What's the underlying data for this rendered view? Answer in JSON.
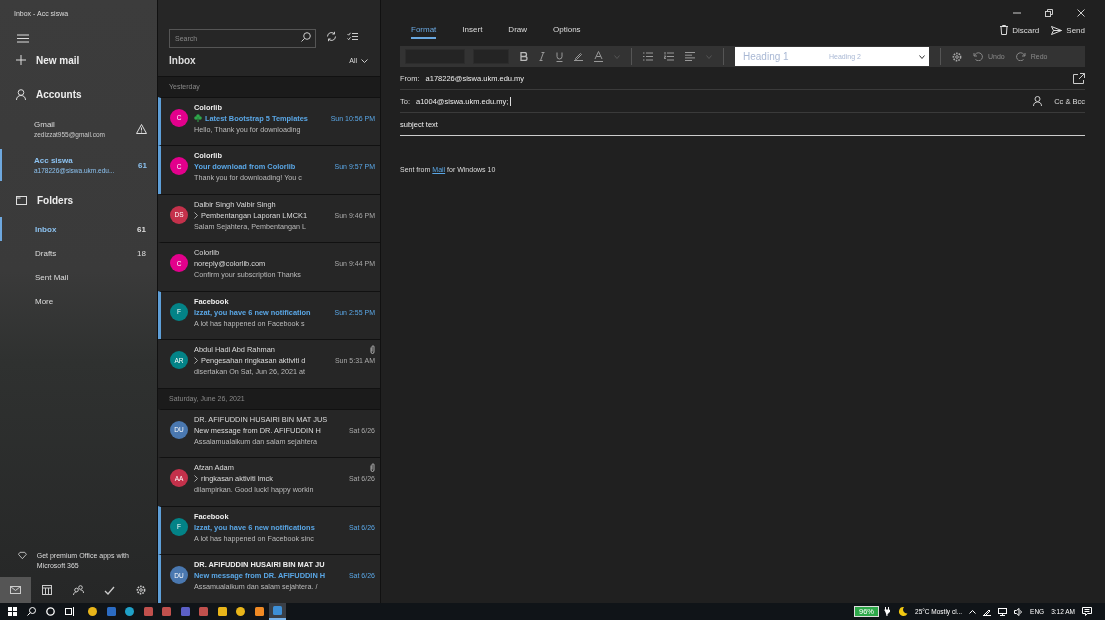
{
  "window": {
    "title": "Inbox - Acc siswa"
  },
  "sidebar": {
    "new_mail": "New mail",
    "accounts_header": "Accounts",
    "accounts": [
      {
        "name": "Gmail",
        "email": "zedizzat955@gmail.com",
        "warning": true,
        "selected": false
      },
      {
        "name": "Acc siswa",
        "email": "a178226@siswa.ukm.edu...",
        "count": "61",
        "warning": false,
        "selected": true
      }
    ],
    "folders_header": "Folders",
    "folders": [
      {
        "name": "Inbox",
        "count": "61",
        "selected": true
      },
      {
        "name": "Drafts",
        "count": "18",
        "selected": false
      },
      {
        "name": "Sent Mail",
        "selected": false
      },
      {
        "name": "More",
        "selected": false
      }
    ],
    "promo": "Get premium Office apps with Microsoft 365",
    "nav": [
      {
        "kind": "mail",
        "selected": true
      },
      {
        "kind": "calendar",
        "selected": false
      },
      {
        "kind": "people",
        "selected": false
      },
      {
        "kind": "todo",
        "selected": false
      },
      {
        "kind": "settings",
        "selected": false
      }
    ]
  },
  "message_list": {
    "search": {
      "placeholder": "Search"
    },
    "title": "Inbox",
    "filter": "All",
    "groups": [
      {
        "label": "Yesterday",
        "messages": [
          {
            "initials": "C",
            "color": "#e3008c",
            "sender": "Colorlib",
            "subject": "Latest Bootstrap 5 Templates",
            "kind": "clover",
            "preview": "Hello, Thank you for downloading",
            "time": "Sun 10:56 PM",
            "unread": true,
            "attachment": false
          },
          {
            "initials": "C",
            "color": "#e3008c",
            "sender": "Colorlib",
            "subject": "Your download from Colorlib",
            "kind": "plain",
            "preview": "Thank you for downloading! You c",
            "time": "Sun 9:57 PM",
            "unread": true,
            "attachment": false
          },
          {
            "initials": "DS",
            "color": "#c4314b",
            "sender": "Dalbir Singh Valbir Singh",
            "subject": "Pembentangan Laporan LMCK1",
            "kind": "reply",
            "preview": "Salam Sejahtera, Pembentangan L",
            "time": "Sun 9:46 PM",
            "unread": false,
            "attachment": false
          },
          {
            "initials": "C",
            "color": "#e3008c",
            "sender": "Colorlib",
            "subject": "noreply@colorlib.com",
            "kind": "plain",
            "preview": "Confirm your subscription Thanks",
            "time": "Sun 9:44 PM",
            "unread": false,
            "attachment": false
          },
          {
            "initials": "F",
            "color": "#038387",
            "sender": "Facebook",
            "subject": "Izzat, you have 6 new notification",
            "kind": "plain",
            "preview": "A lot has happened on Facebook s",
            "time": "Sun 2:55 PM",
            "unread": true,
            "attachment": false
          },
          {
            "initials": "AR",
            "color": "#038387",
            "sender": "Abdul Hadi Abd Rahman",
            "subject": "Pengesahan ringkasan aktiviti d",
            "kind": "reply",
            "preview": "disertakan On Sat, Jun 26, 2021 at",
            "time": "Sun 5:31 AM",
            "unread": false,
            "attachment": true
          }
        ]
      },
      {
        "label": "Saturday, June 26, 2021",
        "messages": [
          {
            "initials": "DU",
            "color": "#4a78b0",
            "sender": "DR. AFIFUDDIN HUSAIRI BIN MAT JUS",
            "subject": "New message from DR. AFIFUDDIN H",
            "kind": "plain",
            "preview": "Assalamualaikum dan salam sejahtera",
            "time": "Sat 6/26",
            "unread": false,
            "attachment": false
          },
          {
            "initials": "AA",
            "color": "#c4314b",
            "sender": "Afzan Adam",
            "subject": "ringkasan aktiviti lmck",
            "kind": "reply",
            "preview": "dilampirkan. Good luck! happy workin",
            "time": "Sat 6/26",
            "unread": false,
            "attachment": true
          },
          {
            "initials": "F",
            "color": "#038387",
            "sender": "Facebook",
            "subject": "Izzat, you have 6 new notifications",
            "kind": "plain",
            "preview": "A lot has happened on Facebook sinc",
            "time": "Sat 6/26",
            "unread": true,
            "attachment": false
          },
          {
            "initials": "DU",
            "color": "#4a78b0",
            "sender": "DR. AFIFUDDIN HUSAIRI BIN MAT JU",
            "subject": "New message from DR. AFIFUDDIN H",
            "kind": "plain",
            "preview": "Assamualaikum dan salam sejahtera. /",
            "time": "Sat 6/26",
            "unread": true,
            "attachment": false
          }
        ]
      }
    ]
  },
  "compose": {
    "tabs": [
      {
        "label": "Format",
        "selected": true
      },
      {
        "label": "Insert",
        "selected": false
      },
      {
        "label": "Draw",
        "selected": false
      },
      {
        "label": "Options",
        "selected": false
      }
    ],
    "discard": "Discard",
    "send": "Send",
    "styles": [
      "Heading 1",
      "Heading 2"
    ],
    "undo": {
      "label": "Undo",
      "disabled": true
    },
    "redo": {
      "label": "Redo",
      "disabled": true
    },
    "from_label": "From:",
    "from": "a178226@siswa.ukm.edu.my",
    "to_label": "To:",
    "to": "a1004@siswa.ukm.edu.my;",
    "cc_bcc": "Cc & Bcc",
    "subject": "subject text",
    "body": "Sent from ",
    "body_link": "Mail",
    "body_end": " for Windows 10"
  },
  "taskbar": {
    "apps": [
      {
        "kind": "chrome",
        "selected": false
      },
      {
        "kind": "word",
        "selected": false
      },
      {
        "kind": "edge",
        "selected": false
      },
      {
        "kind": "app",
        "selected": false
      },
      {
        "kind": "app",
        "selected": false
      },
      {
        "kind": "teams",
        "selected": false
      },
      {
        "kind": "app",
        "selected": false
      },
      {
        "kind": "folder",
        "selected": false
      },
      {
        "kind": "chrome",
        "selected": false
      },
      {
        "kind": "sublime",
        "selected": false
      },
      {
        "kind": "mail",
        "selected": true
      }
    ],
    "battery": "96%",
    "weather": "25°C Mostly cl...",
    "language": "ENG",
    "time": "3:12 AM"
  }
}
